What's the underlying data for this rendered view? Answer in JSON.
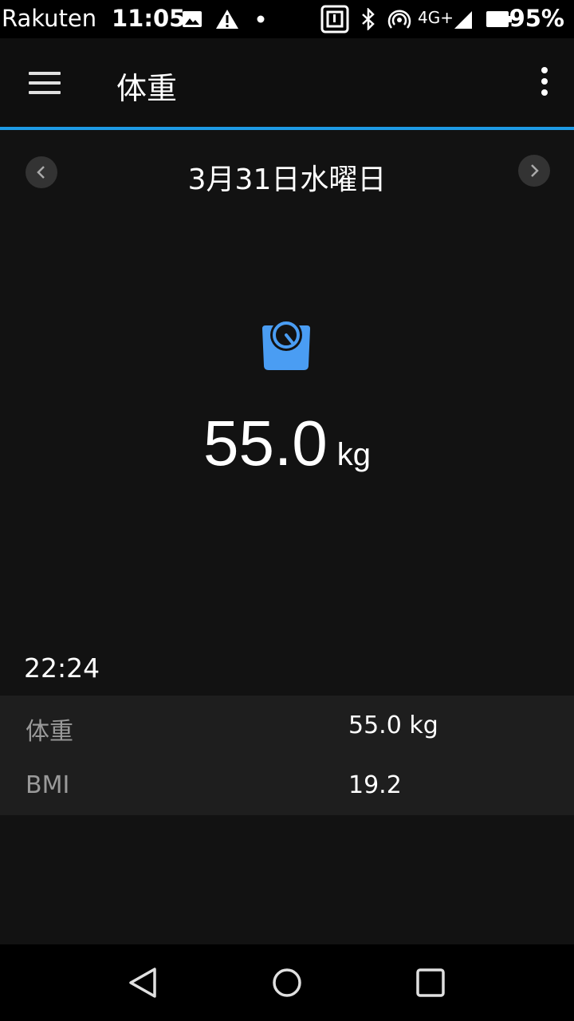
{
  "status_bar": {
    "carrier": "Rakuten",
    "time": "11:05",
    "network": "4G+",
    "battery": "95%"
  },
  "app_bar": {
    "title": "体重"
  },
  "date_nav": {
    "date": "3月31日水曜日"
  },
  "summary": {
    "weight_value": "55.0",
    "weight_unit": "kg",
    "icon": "scale-icon"
  },
  "entry": {
    "time": "22:24",
    "rows": [
      {
        "label": "体重",
        "value": "55.0 kg"
      },
      {
        "label": "BMI",
        "value": "19.2"
      }
    ]
  },
  "colors": {
    "accent": "#1e9be5",
    "icon": "#4a9df3",
    "background": "#121212"
  }
}
